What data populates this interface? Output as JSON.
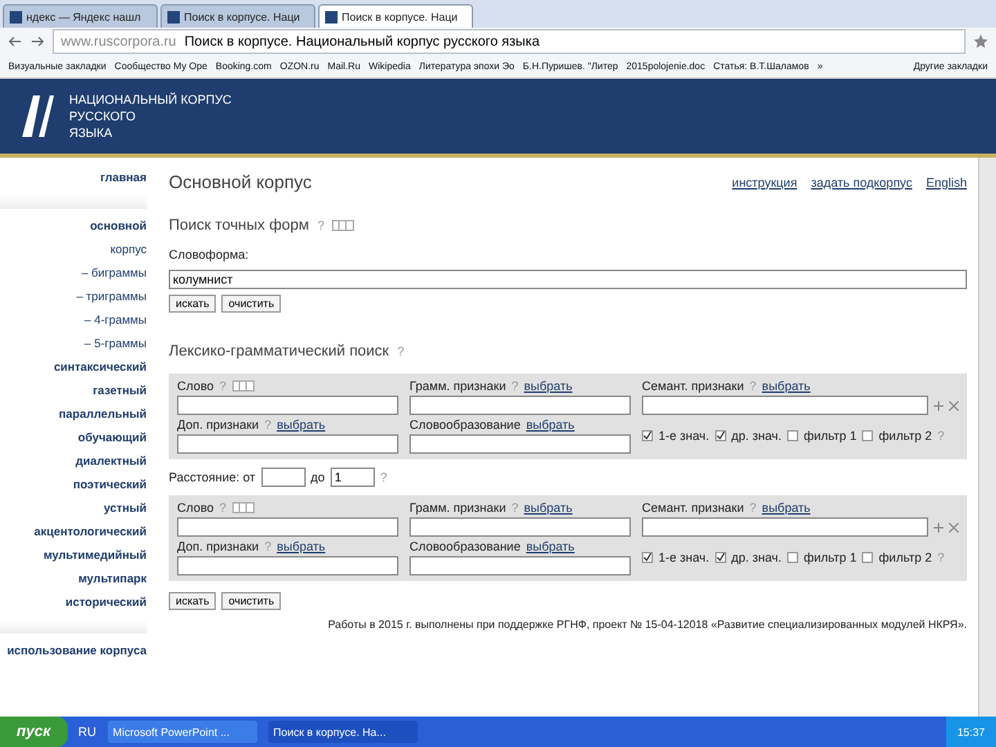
{
  "browser": {
    "tabs": [
      {
        "title": "ндекс — Яндекс нашл",
        "selected": false
      },
      {
        "title": "Поиск в корпусе. Наци",
        "selected": false
      },
      {
        "title": "Поиск в корпусе. Наци",
        "selected": true
      }
    ],
    "url_domain": "www.ruscorpora.ru",
    "url_title": "Поиск в корпусе. Национальный корпус русского языка",
    "bookmarks": [
      "Визуальные закладки",
      "Сообщество My Ope",
      "Booking.com",
      "OZON.ru",
      "Mail.Ru",
      "Wikipedia",
      "Литература эпохи Эо",
      "Б.Н.Пуришев. \"Литер",
      "2015polojenie.doc",
      "Статья: В.Т.Шаламов",
      "»"
    ],
    "other_bookmarks": "Другие закладки"
  },
  "site": {
    "logo_lines": [
      "НАЦИОНАЛЬНЫЙ КОРПУС",
      "РУССКОГО",
      "ЯЗЫКА"
    ]
  },
  "nav": {
    "home": "главная",
    "items": [
      "основной",
      "корпус",
      "– биграммы",
      "– триграммы",
      "– 4-граммы",
      "– 5-граммы"
    ],
    "corpora": [
      "синтаксический",
      "газетный",
      "параллельный",
      "обучающий",
      "диалектный",
      "поэтический",
      "устный",
      "акцентологический",
      "мультимедийный",
      "мультипарк",
      "исторический"
    ],
    "usage": "использование корпуса"
  },
  "main": {
    "title": "Основной корпус",
    "links": [
      "инструкция",
      "задать подкорпус",
      "English"
    ],
    "exact": {
      "title": "Поиск точных форм",
      "help": "?",
      "label": "Словоформа:",
      "value": "колумнист",
      "buttons": [
        "искать",
        "очистить"
      ]
    },
    "lexgram": {
      "title": "Лексико-грамматический поиск",
      "help": "?",
      "blocks": [
        {
          "word_label": "Слово",
          "gram_label": "Грамм. признаки",
          "gram_link": "выбрать",
          "sem_label": "Семант. признаки",
          "sem_link": "выбрать",
          "add_label": "Доп. признаки",
          "add_link": "выбрать",
          "deriv_label": "Словообразование",
          "deriv_link": "выбрать",
          "checks": [
            {
              "label": "1-е знач.",
              "checked": true
            },
            {
              "label": "др. знач.",
              "checked": true
            },
            {
              "label": "фильтр 1",
              "checked": false
            },
            {
              "label": "фильтр 2",
              "checked": false
            }
          ]
        },
        {
          "word_label": "Слово",
          "gram_label": "Грамм. признаки",
          "gram_link": "выбрать",
          "sem_label": "Семант. признаки",
          "sem_link": "выбрать",
          "add_label": "Доп. признаки",
          "add_link": "выбрать",
          "deriv_label": "Словообразование",
          "deriv_link": "выбрать",
          "checks": [
            {
              "label": "1-е знач.",
              "checked": true
            },
            {
              "label": "др. знач.",
              "checked": true
            },
            {
              "label": "фильтр 1",
              "checked": false
            },
            {
              "label": "фильтр 2",
              "checked": false
            }
          ]
        }
      ],
      "distance": {
        "label": "Расстояние: от",
        "to_label": "до",
        "to_value": "1"
      },
      "buttons": [
        "искать",
        "очистить"
      ]
    },
    "footer": "Работы в 2015 г. выполнены при поддержке РГНФ, проект № 15-04-12018 «Развитие специализированных модулей НКРЯ»."
  },
  "taskbar": {
    "start": "пуск",
    "lang": "RU",
    "tasks": [
      {
        "title": "Microsoft PowerPoint ...",
        "selected": false
      },
      {
        "title": "Поиск в корпусе. На...",
        "selected": true
      }
    ],
    "time": "15:37"
  }
}
